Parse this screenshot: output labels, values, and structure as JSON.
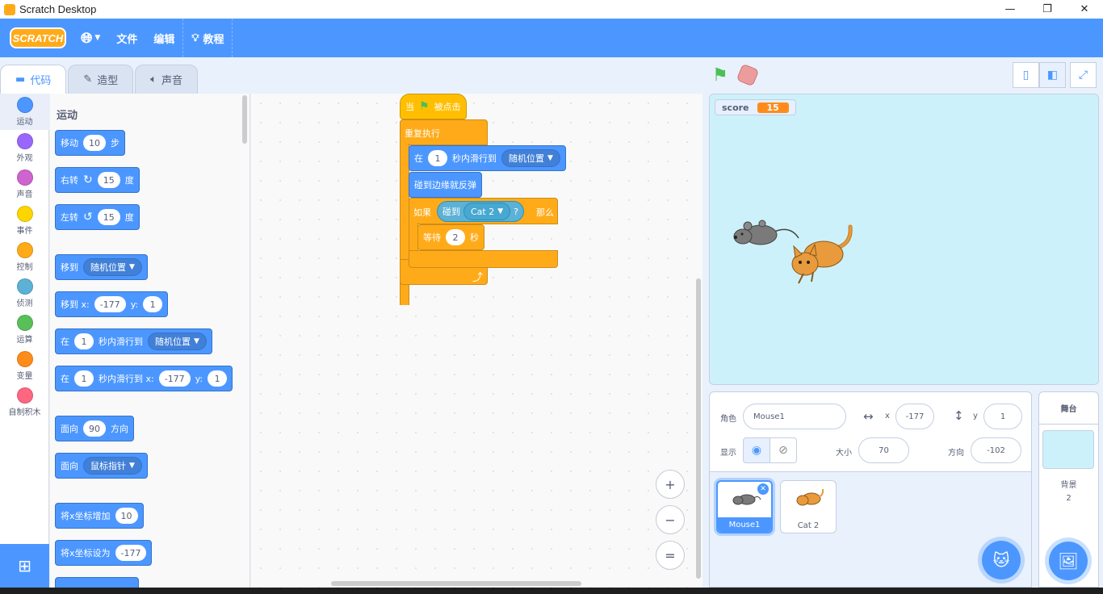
{
  "window": {
    "title": "Scratch Desktop",
    "controls": [
      "—",
      "❐",
      "✕"
    ]
  },
  "menubar": {
    "logo": "SCRATCH",
    "language_icon": "globe-icon",
    "file": "文件",
    "edit": "编辑",
    "tutorials": "教程"
  },
  "tabs": [
    {
      "label": "代码"
    },
    {
      "label": "造型"
    },
    {
      "label": "声音"
    }
  ],
  "categories": [
    {
      "label": "运动",
      "color": "#4c97ff"
    },
    {
      "label": "外观",
      "color": "#9966ff"
    },
    {
      "label": "声音",
      "color": "#cf63cf"
    },
    {
      "label": "事件",
      "color": "#ffd500"
    },
    {
      "label": "控制",
      "color": "#ffab19"
    },
    {
      "label": "侦测",
      "color": "#5cb1d6"
    },
    {
      "label": "运算",
      "color": "#59c059"
    },
    {
      "label": "变量",
      "color": "#ff8c1a"
    },
    {
      "label": "自制积木",
      "color": "#ff6680"
    }
  ],
  "palette": {
    "title": "运动",
    "move": {
      "text": "移动",
      "steps": "10",
      "unit": "步"
    },
    "turn_right": {
      "text": "右转",
      "deg": "15",
      "unit": "度"
    },
    "turn_left": {
      "text": "左转",
      "deg": "15",
      "unit": "度"
    },
    "goto": {
      "text": "移到",
      "target": "随机位置"
    },
    "goto_xy": {
      "text": "移到 x:",
      "x": "-177",
      "ylabel": "y:",
      "y": "1"
    },
    "glide_to": {
      "pre": "在",
      "secs": "1",
      "mid": "秒内滑行到",
      "target": "随机位置"
    },
    "glide_xy": {
      "pre": "在",
      "secs": "1",
      "mid": "秒内滑行到 x:",
      "x": "-177",
      "ylabel": "y:",
      "y": "1"
    },
    "point_dir": {
      "text": "面向",
      "deg": "90",
      "unit": "方向"
    },
    "point_towards": {
      "text": "面向",
      "target": "鼠标指针"
    },
    "change_x": {
      "text": "将x坐标增加",
      "val": "10"
    },
    "set_x": {
      "text": "将x坐标设为",
      "val": "-177"
    }
  },
  "script": {
    "hat": {
      "pre": "当",
      "post": "被点击"
    },
    "forever": "重复执行",
    "glide": {
      "pre": "在",
      "secs": "1",
      "mid": "秒内滑行到",
      "target": "随机位置"
    },
    "bounce": "碰到边缘就反弹",
    "if": {
      "pre": "如果",
      "post": "那么"
    },
    "touching": {
      "text": "碰到",
      "target": "Cat 2",
      "q": "?"
    },
    "wait": {
      "text": "等待",
      "secs": "2",
      "unit": "秒"
    }
  },
  "zoom": {
    "in": "+",
    "out": "−",
    "reset": "="
  },
  "stage": {
    "monitor": {
      "name": "score",
      "value": "15"
    }
  },
  "sprite_info": {
    "sprite_label": "角色",
    "sprite_name": "Mouse1",
    "x_label": "x",
    "x": "-177",
    "y_label": "y",
    "y": "1",
    "show_label": "显示",
    "size_label": "大小",
    "size": "70",
    "dir_label": "方向",
    "direction": "-102"
  },
  "sprites": [
    {
      "name": "Mouse1",
      "selected": true
    },
    {
      "name": "Cat 2",
      "selected": false
    }
  ],
  "stage_panel": {
    "title": "舞台",
    "backdrop_label": "背景",
    "backdrop_count": "2"
  }
}
